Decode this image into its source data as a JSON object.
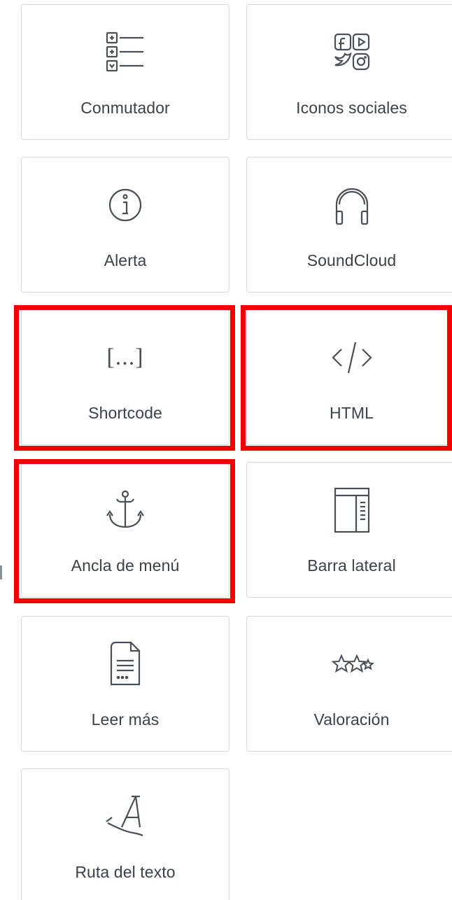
{
  "widgets": [
    {
      "label": "Conmutador",
      "icon": "toggle-list-icon",
      "highlighted": false
    },
    {
      "label": "Iconos sociales",
      "icon": "social-icons-icon",
      "highlighted": false
    },
    {
      "label": "Alerta",
      "icon": "info-alert-icon",
      "highlighted": false
    },
    {
      "label": "SoundCloud",
      "icon": "headphones-icon",
      "highlighted": false
    },
    {
      "label": "Shortcode",
      "icon": "shortcode-brackets-icon",
      "glyph": "[...]",
      "highlighted": true
    },
    {
      "label": "HTML",
      "icon": "code-brackets-icon",
      "highlighted": true
    },
    {
      "label": "Ancla de menú",
      "icon": "anchor-icon",
      "highlighted": true
    },
    {
      "label": "Barra lateral",
      "icon": "sidebar-layout-icon",
      "highlighted": false
    },
    {
      "label": "Leer más",
      "icon": "document-icon",
      "highlighted": false
    },
    {
      "label": "Valoración",
      "icon": "stars-icon",
      "highlighted": false
    },
    {
      "label": "Ruta del texto",
      "icon": "text-path-icon",
      "highlighted": false
    }
  ],
  "colors": {
    "highlight": "#f20000",
    "tile_border": "#d5d8dc",
    "icon": "#4a4f55",
    "label": "#3c4147"
  }
}
